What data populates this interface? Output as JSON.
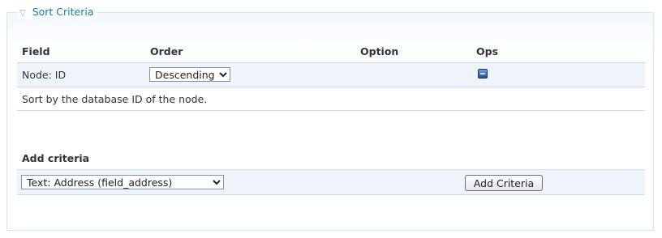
{
  "fieldset": {
    "legend_icon": "triangle-down-icon",
    "legend": "Sort Criteria"
  },
  "table": {
    "headers": {
      "field": "Field",
      "order": "Order",
      "option": "Option",
      "ops": "Ops"
    },
    "row": {
      "field": "Node: ID",
      "order_selected": "Descending",
      "ops_icon": "delete-icon",
      "description": "Sort by the database ID of the node."
    }
  },
  "add": {
    "heading": "Add criteria",
    "selected": "Text: Address (field_address)",
    "button": "Add Criteria"
  }
}
